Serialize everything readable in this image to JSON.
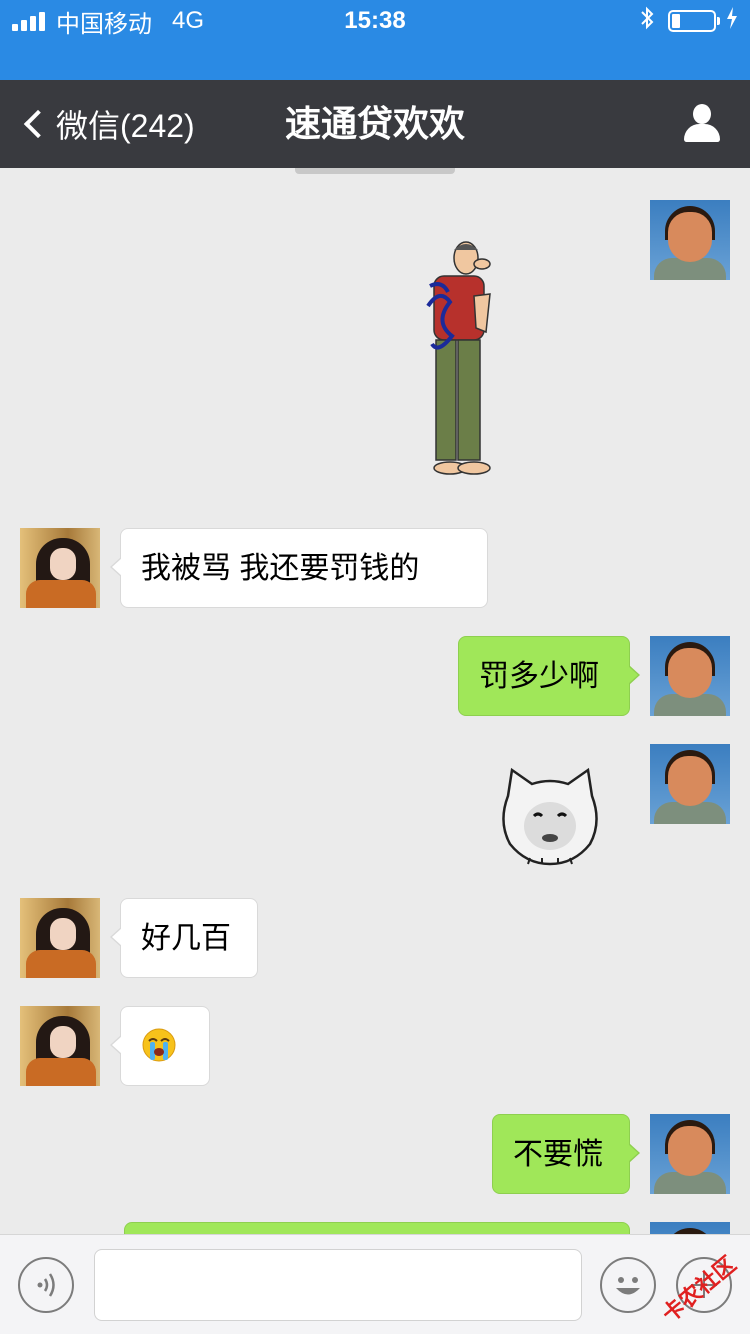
{
  "status_bar": {
    "carrier": "中国移动",
    "network": "4G",
    "time": "15:38",
    "signal_bars": 4,
    "battery_level": 0.2,
    "icons": [
      "signal-icon",
      "bluetooth-icon",
      "battery-icon",
      "charging-icon"
    ]
  },
  "nav": {
    "back_label": "微信(242)",
    "title": "速通贷欢欢",
    "profile_icon": "person-icon"
  },
  "messages": [
    {
      "sender": "me",
      "type": "sticker",
      "sticker": "praying-man-sticker"
    },
    {
      "sender": "other",
      "type": "text",
      "text": "我被骂  我还要罚钱的"
    },
    {
      "sender": "me",
      "type": "text",
      "text": "罚多少啊"
    },
    {
      "sender": "me",
      "type": "sticker",
      "sticker": "sad-cat-face-sticker"
    },
    {
      "sender": "other",
      "type": "text",
      "text": "好几百"
    },
    {
      "sender": "other",
      "type": "emoji",
      "emoji": "crying-face-icon"
    },
    {
      "sender": "me",
      "type": "text",
      "text": "不要慌"
    },
    {
      "sender": "me",
      "type": "text",
      "text": ""
    }
  ],
  "input_bar": {
    "text_value": "",
    "placeholder": "",
    "icons": [
      "voice-icon",
      "emoji-icon",
      "plus-icon"
    ]
  },
  "watermark": "卡农社区",
  "colors": {
    "status_bar": "#2a8ae4",
    "nav_bar": "#393a3f",
    "chat_bg": "#ebebeb",
    "bubble_out": "#a0e759",
    "bubble_in": "#ffffff"
  }
}
